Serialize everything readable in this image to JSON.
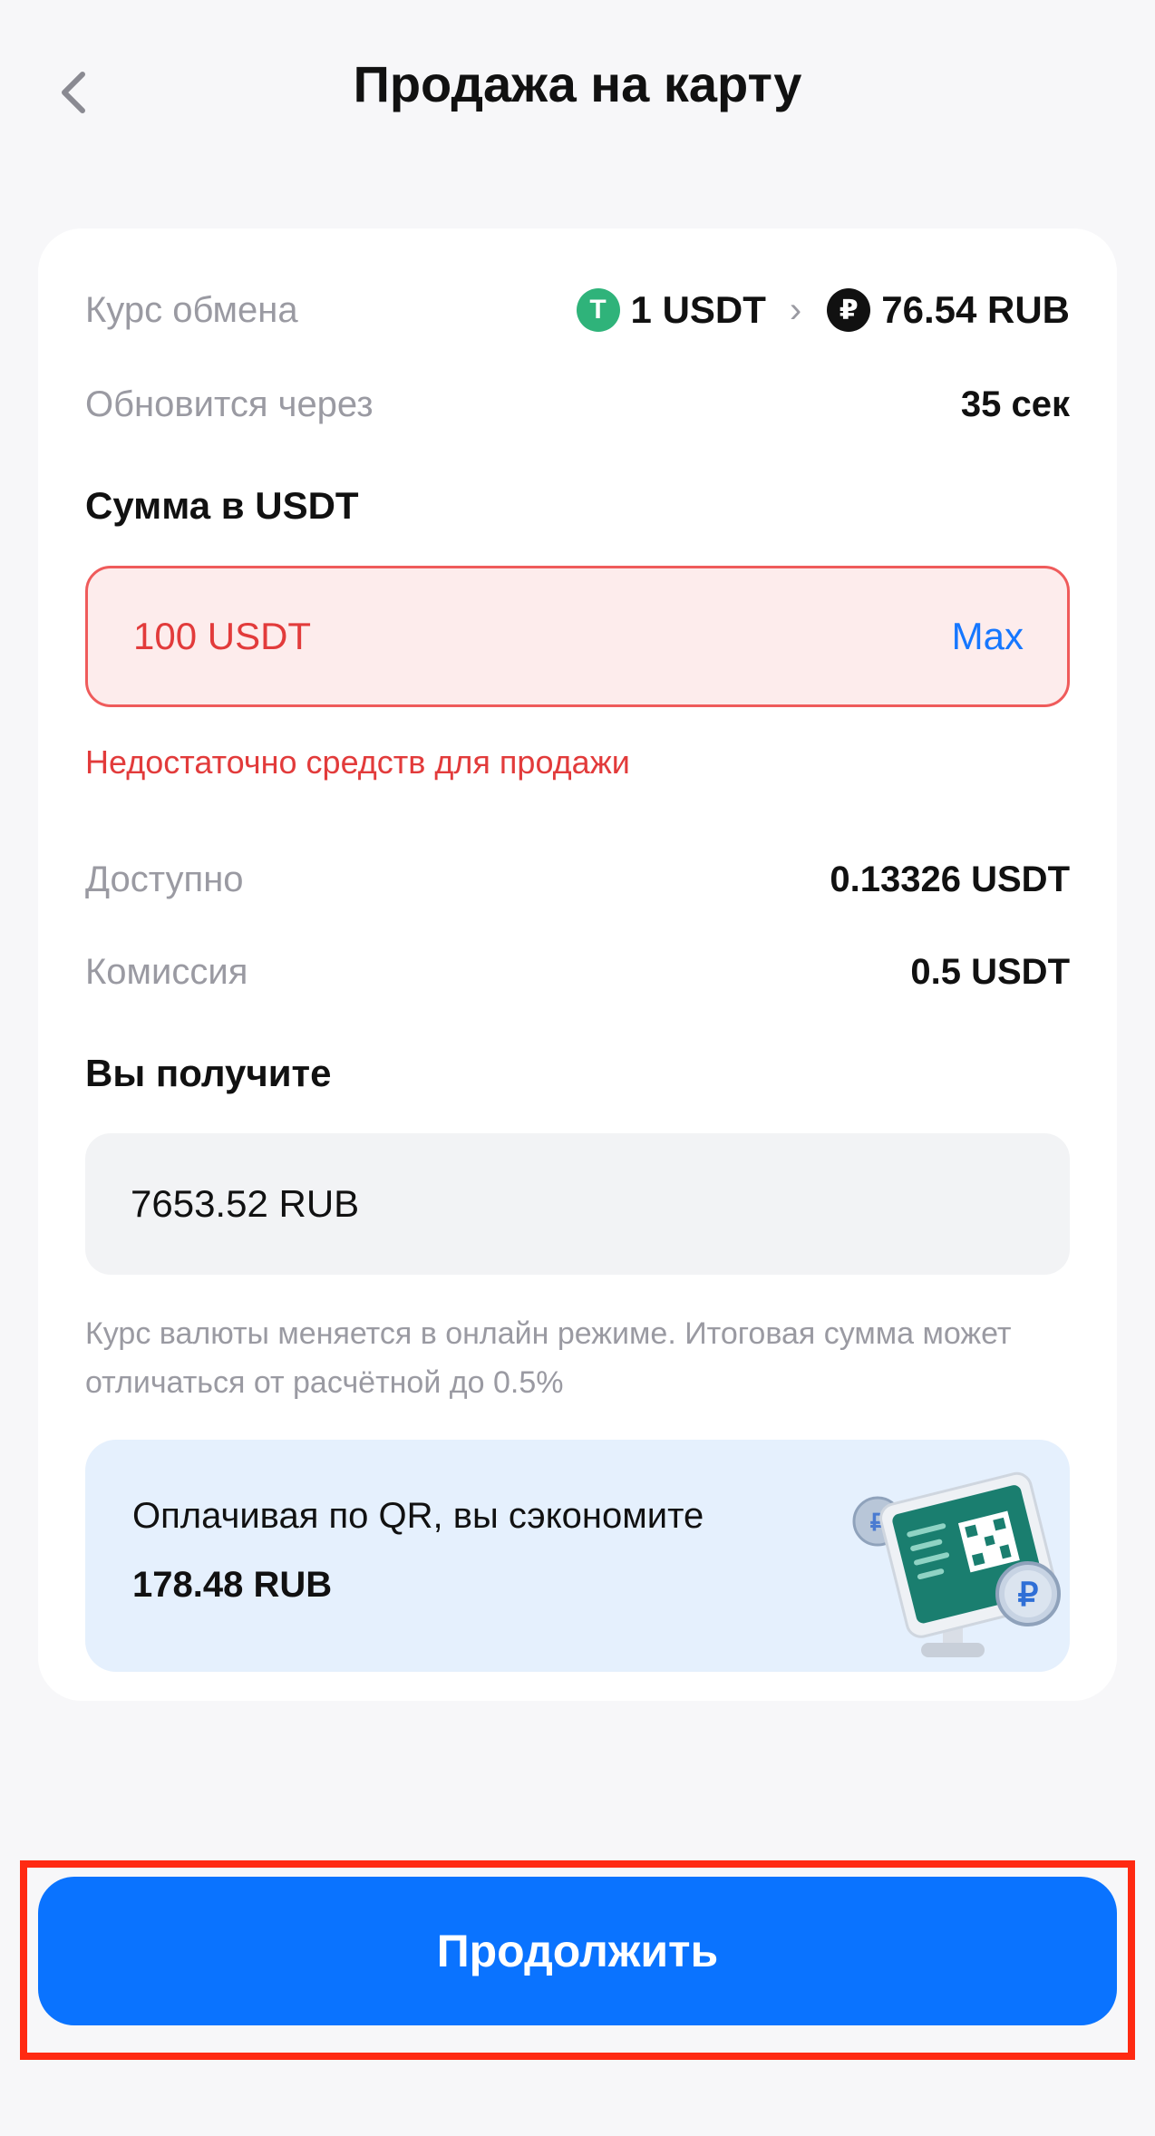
{
  "header": {
    "title": "Продажа на карту"
  },
  "rate": {
    "label": "Курс обмена",
    "from": "1 USDT",
    "to": "76.54 RUB",
    "from_icon": "usdt-icon",
    "to_icon": "ruble-icon",
    "from_icon_glyph": "T",
    "to_icon_glyph": "₽"
  },
  "refresh": {
    "label": "Обновится через",
    "value": "35 сек"
  },
  "amount": {
    "title": "Сумма в USDT",
    "value": "100 USDT",
    "max_label": "Max",
    "error": "Недостаточно средств для продажи"
  },
  "available": {
    "label": "Доступно",
    "value": "0.13326 USDT"
  },
  "fee": {
    "label": "Комиссия",
    "value": "0.5 USDT"
  },
  "receive": {
    "title": "Вы получите",
    "value": "7653.52 RUB"
  },
  "disclaimer": "Курс валюты меняется в онлайн режиме. Итоговая сумма может отличаться от расчётной до 0.5%",
  "promo": {
    "line1": "Оплачивая по QR, вы сэкономите",
    "line2": "178.48 RUB",
    "image": "qr-terminal-illustration"
  },
  "continue_label": "Продолжить",
  "colors": {
    "accent": "#0a73ff",
    "error": "#e23b3b",
    "usdt": "#2fb37a",
    "highlight": "#ff2a12"
  }
}
